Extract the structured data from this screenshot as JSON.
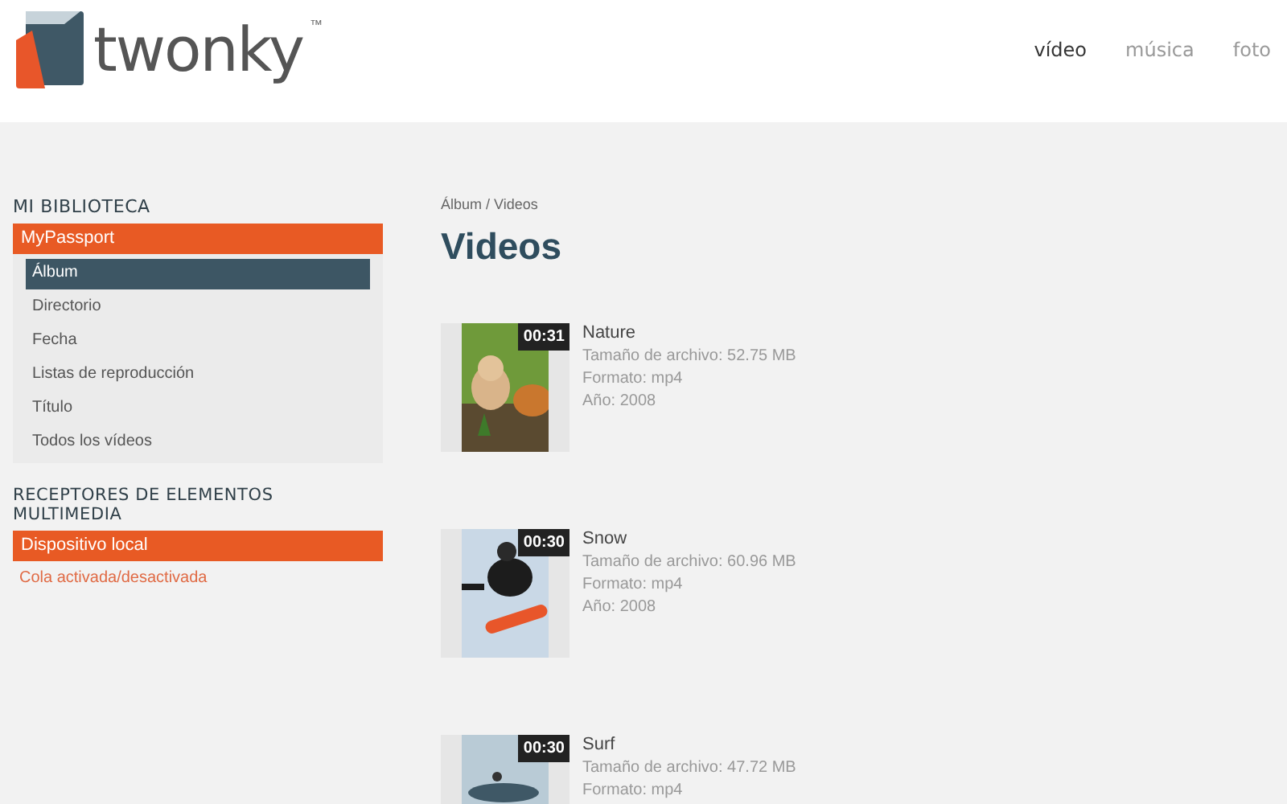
{
  "header": {
    "logo": "twonky",
    "logo_mark": "™",
    "nav": [
      {
        "label": "vídeo",
        "selected": true
      },
      {
        "label": "música",
        "selected": false
      },
      {
        "label": "foto",
        "selected": false
      }
    ]
  },
  "sidebar": {
    "library_title": "MI BIBLIOTECA",
    "server": "MyPassport",
    "items": [
      {
        "label": "Álbum",
        "selected": true
      },
      {
        "label": "Directorio",
        "selected": false
      },
      {
        "label": "Fecha",
        "selected": false
      },
      {
        "label": "Listas de reproducción",
        "selected": false
      },
      {
        "label": "Título",
        "selected": false
      },
      {
        "label": "Todos los vídeos",
        "selected": false
      }
    ],
    "renderers_title": "RECEPTORES DE ELEMENTOS MULTIMEDIA",
    "renderer": "Dispositivo local",
    "queue_link": "Cola activada/desactivada"
  },
  "content": {
    "breadcrumb": "Álbum / Videos",
    "title": "Videos",
    "videos": [
      {
        "title": "Nature",
        "duration": "00:31",
        "details": [
          "Tamaño de archivo: 52.75 MB",
          "Formato: mp4",
          "Año: 2008"
        ]
      },
      {
        "title": "Snow",
        "duration": "00:30",
        "details": [
          "Tamaño de archivo: 60.96 MB",
          "Formato: mp4",
          "Año: 2008"
        ]
      },
      {
        "title": "Surf",
        "duration": "00:30",
        "details": [
          "Tamaño de archivo: 47.72 MB",
          "Formato: mp4"
        ]
      }
    ]
  }
}
